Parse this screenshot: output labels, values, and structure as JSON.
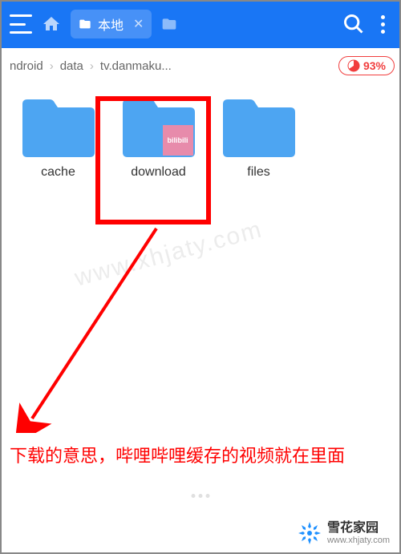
{
  "header": {
    "tab_label": "本地"
  },
  "breadcrumb": {
    "items": [
      "ndroid",
      "data",
      "tv.danmaku..."
    ]
  },
  "storage": {
    "percent": "93%"
  },
  "folders": [
    {
      "label": "cache",
      "has_overlay": false
    },
    {
      "label": "download",
      "has_overlay": true,
      "overlay_text": "bilibili"
    },
    {
      "label": "files",
      "has_overlay": false
    }
  ],
  "annotation": {
    "text": "下载的意思，哔哩哔哩缓存的视频就在里面"
  },
  "watermark": {
    "text": "www.xhjaty.com"
  },
  "logo": {
    "title": "雪花家园",
    "url": "www.xhjaty.com"
  },
  "colors": {
    "header_bg": "#1976f5",
    "folder": "#4da5f2",
    "highlight": "#ff0000",
    "storage_badge": "#f13e3e",
    "overlay": "#e78bab",
    "logo_accent": "#1e90ff"
  }
}
